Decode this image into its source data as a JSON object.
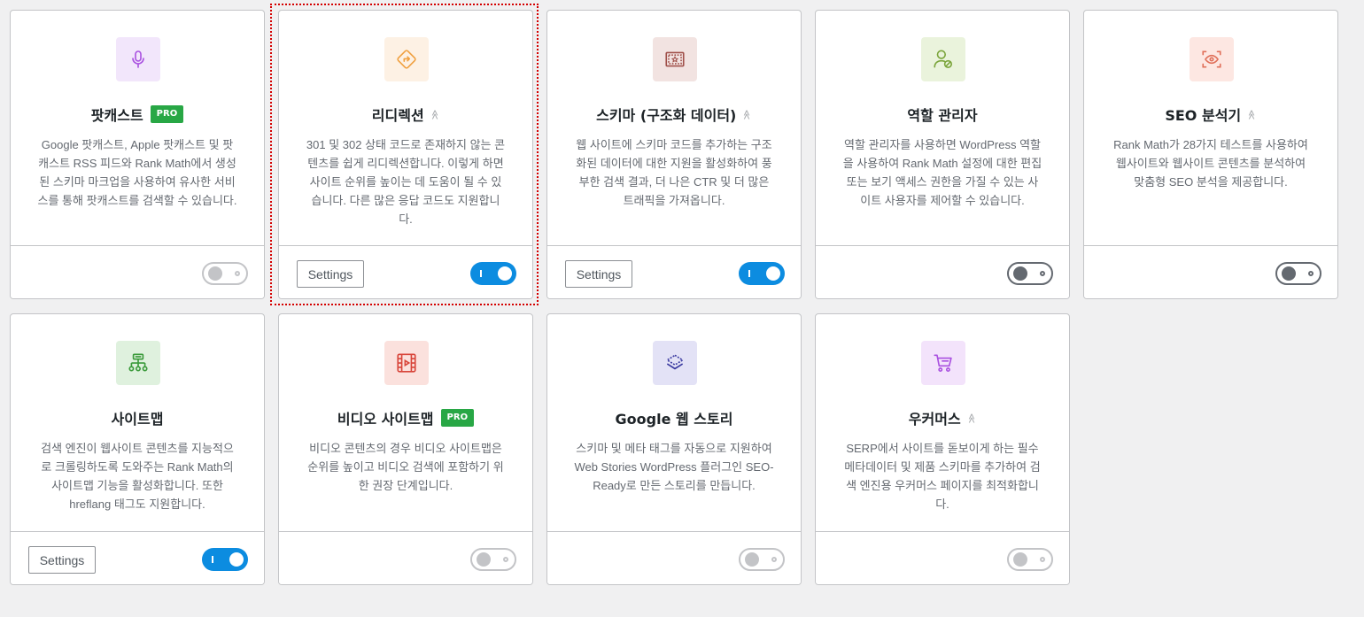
{
  "modules": [
    {
      "key": "podcast",
      "title": "팟캐스트",
      "badge": "PRO",
      "description": "Google 팟캐스트, Apple 팟캐스트 및 팟캐스트 RSS 피드와 Rank Math에서 생성된 스키마 마크업을 사용하여 유사한 서비스를 통해 팟캐스트를 검색할 수 있습니다.",
      "settings_label": "",
      "toggle_state": "disabled",
      "icon": "microphone-icon",
      "icon_bg": "#f2e6fb",
      "icon_color": "#a950e0"
    },
    {
      "key": "redirection",
      "title": "리디렉션",
      "badge": "",
      "description": "301 및 302 상태 코드로 존재하지 않는 콘텐츠를 쉽게 리디렉션합니다. 이렇게 하면 사이트 순위를 높이는 데 도움이 될 수 있습니다. 다른 많은 응답 코드도 지원합니다.",
      "settings_label": "Settings",
      "toggle_state": "on",
      "icon": "redirect-arrow-icon",
      "icon_bg": "#fdf1e4",
      "icon_color": "#f0a040"
    },
    {
      "key": "schema",
      "title": "스키마 (구조화 데이터)",
      "badge": "",
      "description": "웹 사이트에 스키마 코드를 추가하는 구조화된 데이터에 대한 지원을 활성화하여 풍부한 검색 결과, 더 나은 CTR 및 더 많은 트래픽을 가져옵니다.",
      "settings_label": "Settings",
      "toggle_state": "on",
      "icon": "certificate-icon",
      "icon_bg": "#f2e3e1",
      "icon_color": "#a0504a"
    },
    {
      "key": "role-manager",
      "title": "역할 관리자",
      "badge": "",
      "description": "역할 관리자를 사용하면 WordPress 역할을 사용하여 Rank Math 설정에 대한 편집 또는 보기 액세스 권한을 가질 수 있는 사이트 사용자를 제어할 수 있습니다.",
      "settings_label": "",
      "toggle_state": "off",
      "icon": "user-role-icon",
      "icon_bg": "#eaf3dc",
      "icon_color": "#7aa43a"
    },
    {
      "key": "seo-analysis",
      "title": "SEO 분석기",
      "badge": "",
      "description": "Rank Math가 28가지 테스트를 사용하여 웹사이트와 웹사이트 콘텐츠를 분석하여 맞춤형 SEO 분석을 제공합니다.",
      "settings_label": "",
      "toggle_state": "off",
      "icon": "eye-scan-icon",
      "icon_bg": "#fde7e2",
      "icon_color": "#e0705a"
    },
    {
      "key": "sitemap",
      "title": "사이트맵",
      "badge": "",
      "description": "검색 엔진이 웹사이트 콘텐츠를 지능적으로 크롤링하도록 도와주는 Rank Math의 사이트맵 기능을 활성화합니다. 또한 hreflang 태그도 지원합니다.",
      "settings_label": "Settings",
      "toggle_state": "on",
      "icon": "sitemap-icon",
      "icon_bg": "#dff1de",
      "icon_color": "#3a9a3a"
    },
    {
      "key": "video-sitemap",
      "title": "비디오 사이트맵",
      "badge": "PRO",
      "description": "비디오 콘텐츠의 경우 비디오 사이트맵은 순위를 높이고 비디오 검색에 포함하기 위한 권장 단계입니다.",
      "settings_label": "",
      "toggle_state": "disabled",
      "icon": "film-icon",
      "icon_bg": "#fbe1dd",
      "icon_color": "#d8453a"
    },
    {
      "key": "web-stories",
      "title": "Google 웹 스토리",
      "badge": "",
      "description": "스키마 및 메타 태그를 자동으로 지원하여 Web Stories WordPress 플러그인 SEO-Ready로 만든 스토리를 만듭니다.",
      "settings_label": "",
      "toggle_state": "disabled",
      "icon": "layers-icon",
      "icon_bg": "#e3e2f6",
      "icon_color": "#3a3aa0"
    },
    {
      "key": "woocommerce",
      "title": "우커머스",
      "badge": "",
      "description": "SERP에서 사이트를 돋보이게 하는 필수 메타데이터 및 제품 스키마를 추가하여 검색 엔진용 우커머스 페이지를 최적화합니다.",
      "settings_label": "",
      "toggle_state": "disabled",
      "icon": "cart-icon",
      "icon_bg": "#f3e3fb",
      "icon_color": "#a950e0"
    }
  ],
  "advanced_indicator": "≫"
}
